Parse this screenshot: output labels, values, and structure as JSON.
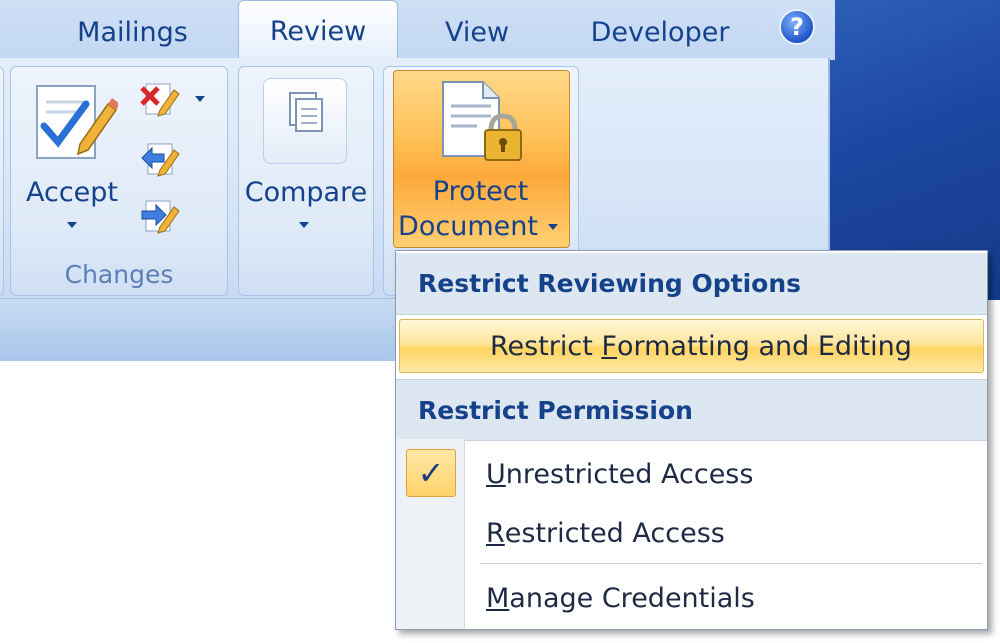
{
  "tabs": {
    "mailings": "Mailings",
    "review": "Review",
    "view": "View",
    "developer": "Developer",
    "help_symbol": "?"
  },
  "ribbon": {
    "changes_group": {
      "accept_label": "Accept",
      "group_label": "Changes"
    },
    "compare_group": {
      "compare_label": "Compare"
    },
    "protect_group": {
      "protect_line1": "Protect",
      "protect_line2": "Document"
    }
  },
  "menu": {
    "header_reviewing": "Restrict Reviewing Options",
    "item_formatting": {
      "prefix": "Restrict ",
      "accel": "F",
      "rest": "ormatting and Editing"
    },
    "header_permission": "Restrict Permission",
    "item_unrestricted": {
      "prefix": "",
      "accel": "U",
      "rest": "nrestricted Access",
      "checked": true
    },
    "item_restricted": {
      "prefix": "",
      "accel": "R",
      "rest": "estricted Access"
    },
    "item_credentials": {
      "prefix": "",
      "accel": "M",
      "rest": "anage Credentials"
    },
    "check_symbol": "✓"
  },
  "colors": {
    "ribbon_text": "#15428b",
    "highlight": "#ffd461",
    "menu_header_bg": "#dde7f1"
  }
}
